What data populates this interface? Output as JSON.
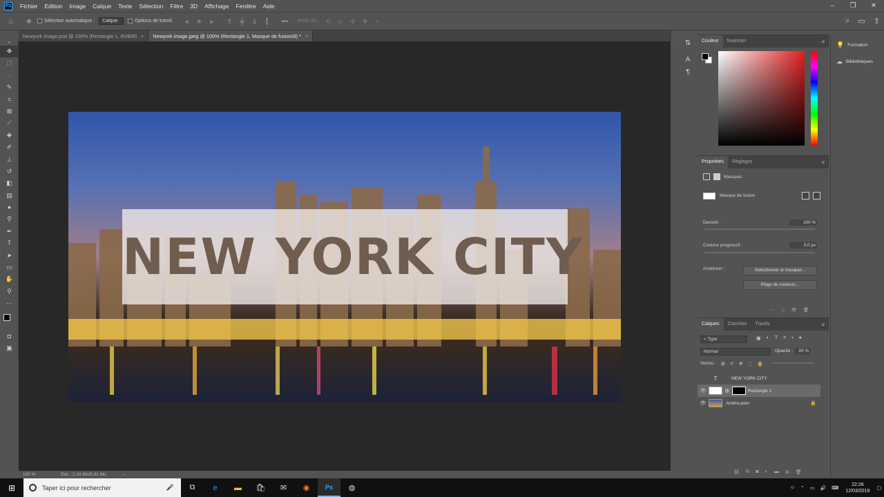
{
  "app": {
    "logo": "Ps"
  },
  "menu": [
    "Fichier",
    "Edition",
    "Image",
    "Calque",
    "Texte",
    "Sélection",
    "Filtre",
    "3D",
    "Affichage",
    "Fenêtre",
    "Aide"
  ],
  "options": {
    "auto_select_label": "Sélection automatique :",
    "auto_select_value": "Calque",
    "transform_label": "Options de transf.",
    "mode3d_label": "Mode 3D :"
  },
  "tabs": [
    {
      "label": "Newyork image.psd @ 100% (Rectangle 1, RVB/8)",
      "close": "×"
    },
    {
      "label": "Newyork image.jpeg @ 100% (Rectangle 1, Masque de fusion/8) *",
      "close": "×"
    }
  ],
  "canvas": {
    "title_text": "NEW YORK CITY"
  },
  "status": {
    "zoom": "100 %",
    "doc": "Doc : 2,16 Mo/5,81 Mo",
    "arrow": "›"
  },
  "color_panel": {
    "tabs": [
      "Couleur",
      "Nuancier"
    ]
  },
  "properties": {
    "tabs": [
      "Propriétés",
      "Réglages"
    ],
    "masks_label": "Masques",
    "mask_type": "Masque de fusion",
    "density_label": "Densité :",
    "density_value": "100 %",
    "feather_label": "Contour progressif :",
    "feather_value": "0,0 px",
    "refine_label": "Améliorer :",
    "select_mask_button": "Sélectionner et masquer...",
    "color_range_button": "Plage de couleurs..."
  },
  "layers": {
    "tabs": [
      "Calques",
      "Couches",
      "Tracés"
    ],
    "filter_kind": "Type",
    "blend_mode": "Normal",
    "opacity_label": "Opacité :",
    "opacity_value": "83 %",
    "lock_label": "Verrou :",
    "items": [
      {
        "name": "NEW YORK CITY",
        "type": "T"
      },
      {
        "name": "Rectangle 1",
        "type": "shape"
      },
      {
        "name": "Arrière-plan",
        "type": "image"
      }
    ]
  },
  "right_dock": {
    "formation": "Formation",
    "bibliotheques": "Bibliothèques"
  },
  "taskbar": {
    "search_placeholder": "Taper ici pour rechercher",
    "time": "22:28",
    "date": "12/03/2019"
  }
}
